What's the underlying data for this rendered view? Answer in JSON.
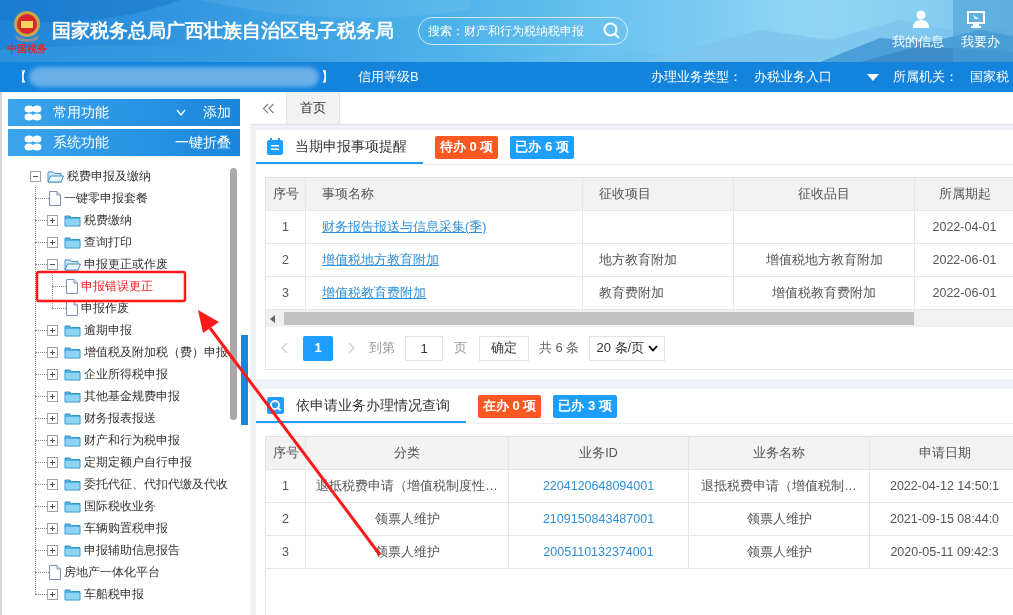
{
  "header": {
    "logo_caption": "中国税务",
    "title": "国家税务总局广西壮族自治区电子税务局",
    "search": {
      "placeholder": "搜索：财产和行为税纳税申报"
    },
    "user_links": [
      {
        "label": "我的信息",
        "kind": "user",
        "selected": false
      },
      {
        "label": "我要办",
        "kind": "monitor",
        "selected": true
      }
    ]
  },
  "info_bar": {
    "bracket_open": "【",
    "bracket_close": "】",
    "credit": "信用等级B",
    "business_type_label": "办理业务类型：",
    "business_type": "办税业务入口",
    "authority_label": "所属机关：",
    "authority": "国家税"
  },
  "sidebar": {
    "panels": [
      {
        "title": "常用功能",
        "action": "添加",
        "expanded": false
      },
      {
        "title": "系统功能",
        "action": "一键折叠",
        "expanded": true
      }
    ],
    "tree": [
      {
        "label": "税费申报及缴纳",
        "kind": "folder",
        "expanded": true,
        "children": [
          {
            "label": "一键零申报套餐",
            "kind": "page",
            "selected": false
          },
          {
            "label": "税费缴纳",
            "kind": "folder",
            "expanded": false
          },
          {
            "label": "查询打印",
            "kind": "folder",
            "expanded": false
          },
          {
            "label": "申报更正或作废",
            "kind": "folder",
            "expanded": true,
            "children": [
              {
                "label": "申报错误更正",
                "kind": "page",
                "selected": true
              },
              {
                "label": "申报作废",
                "kind": "page",
                "selected": false
              }
            ]
          },
          {
            "label": "逾期申报",
            "kind": "folder",
            "expanded": false
          },
          {
            "label": "增值税及附加税（费）申报",
            "kind": "folder",
            "expanded": false
          },
          {
            "label": "企业所得税申报",
            "kind": "folder",
            "expanded": false
          },
          {
            "label": "其他基金规费申报",
            "kind": "folder",
            "expanded": false
          },
          {
            "label": "财务报表报送",
            "kind": "folder",
            "expanded": false
          },
          {
            "label": "财产和行为税申报",
            "kind": "folder",
            "expanded": false
          },
          {
            "label": "定期定额户自行申报",
            "kind": "folder",
            "expanded": false
          },
          {
            "label": "委托代征、代扣代缴及代收",
            "kind": "folder",
            "expanded": false
          },
          {
            "label": "国际税收业务",
            "kind": "folder",
            "expanded": false
          },
          {
            "label": "车辆购置税申报",
            "kind": "folder",
            "expanded": false
          },
          {
            "label": "申报辅助信息报告",
            "kind": "folder",
            "expanded": false
          },
          {
            "label": "房地产一体化平台",
            "kind": "page",
            "selected": false
          },
          {
            "label": "车船税申报",
            "kind": "folder",
            "expanded": false
          }
        ]
      }
    ]
  },
  "tabs": [
    {
      "label": "首页",
      "selected": true
    }
  ],
  "cards": [
    {
      "kind": "calendar",
      "title": "当期申报事项提醒",
      "badges": [
        {
          "label": "待办 0 项",
          "color": "#ff5722"
        },
        {
          "label": "已办 6 项",
          "color": "#1e9fff"
        }
      ],
      "table": {
        "columns": [
          {
            "label": "序号",
            "kind": "plain"
          },
          {
            "label": "事项名称",
            "kind": "link"
          },
          {
            "label": "征收项目",
            "kind": "plain"
          },
          {
            "label": "征收品目",
            "kind": "plain"
          },
          {
            "label": "所属期起",
            "kind": "plain"
          }
        ],
        "rows": [
          [
            "1",
            "财务报告报送与信息采集(季)",
            "",
            "",
            "2022-04-01"
          ],
          [
            "2",
            "增值税地方教育附加",
            "地方教育附加",
            "增值税地方教育附加",
            "2022-06-01"
          ],
          [
            "3",
            "增值税教育费附加",
            "教育费附加",
            "增值税教育费附加",
            "2022-06-01"
          ]
        ]
      },
      "pagination": {
        "pages": [
          {
            "label": "1",
            "selected": true
          }
        ],
        "goto_label": "到第",
        "page_input": "1",
        "page_unit": "页",
        "confirm": "确定",
        "total": "共 6 条",
        "page_size": "20 条/页"
      }
    },
    {
      "kind": "search",
      "title": "依申请业务办理情况查询",
      "badges": [
        {
          "label": "在办 0 项",
          "color": "#ff5722"
        },
        {
          "label": "已办 3 项",
          "color": "#1e9fff"
        }
      ],
      "table": {
        "columns": [
          {
            "label": "序号",
            "kind": "plain"
          },
          {
            "label": "分类",
            "kind": "plain"
          },
          {
            "label": "业务ID",
            "kind": "id"
          },
          {
            "label": "业务名称",
            "kind": "plain"
          },
          {
            "label": "申请日期",
            "kind": "plain"
          }
        ],
        "rows": [
          [
            "1",
            "退抵税费申请（增值税制度性…",
            "2204120648094001",
            "退抵税费申请（增值税制…",
            "2022-04-12 14:50:1"
          ],
          [
            "2",
            "领票人维护",
            "2109150843487001",
            "领票人维护",
            "2021-09-15 08:44:0"
          ],
          [
            "3",
            "领票人维护",
            "2005110132374001",
            "领票人维护",
            "2020-05-11 09:42:3"
          ]
        ]
      }
    }
  ]
}
